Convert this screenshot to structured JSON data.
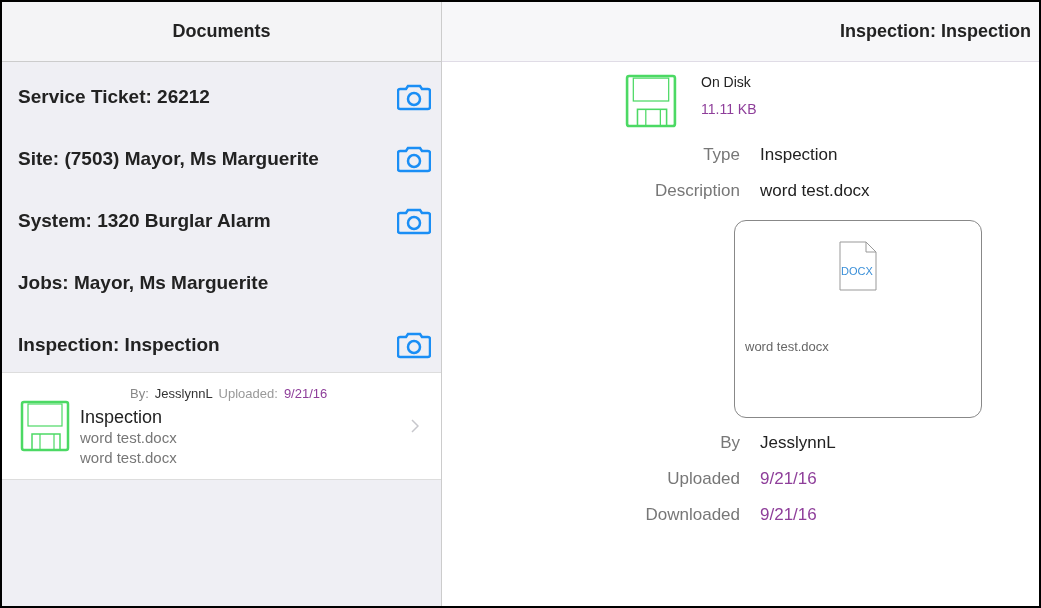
{
  "left_header": {
    "title": "Documents"
  },
  "sections": [
    {
      "title": "Service Ticket: 26212",
      "camera": true
    },
    {
      "title": "Site: (7503) Mayor, Ms Marguerite",
      "camera": true
    },
    {
      "title": "System: 1320 Burglar Alarm",
      "camera": true
    },
    {
      "title": "Jobs: Mayor, Ms Marguerite",
      "camera": false
    },
    {
      "title": "Inspection: Inspection",
      "camera": true
    }
  ],
  "document_row": {
    "by_label": "By:",
    "by": "JesslynnL",
    "uploaded_label": "Uploaded:",
    "uploaded": "9/21/16",
    "title": "Inspection",
    "line_1": "word test.docx",
    "line_2": "word test.docx"
  },
  "right_header": {
    "title": "Inspection: Inspection"
  },
  "detail": {
    "storage": "On Disk",
    "size": "11.11 KB",
    "fields_top": [
      {
        "label": "Type",
        "value": "Inspection",
        "kind": "plain"
      },
      {
        "label": "Description",
        "value": "word test.docx",
        "kind": "plain"
      }
    ],
    "preview": {
      "file_type": "DOCX",
      "file_name": "word test.docx"
    },
    "fields_bottom": [
      {
        "label": "By",
        "value": "JesslynnL",
        "kind": "plain"
      },
      {
        "label": "Uploaded",
        "value": "9/21/16",
        "kind": "date"
      },
      {
        "label": "Downloaded",
        "value": "9/21/16",
        "kind": "date"
      }
    ]
  }
}
